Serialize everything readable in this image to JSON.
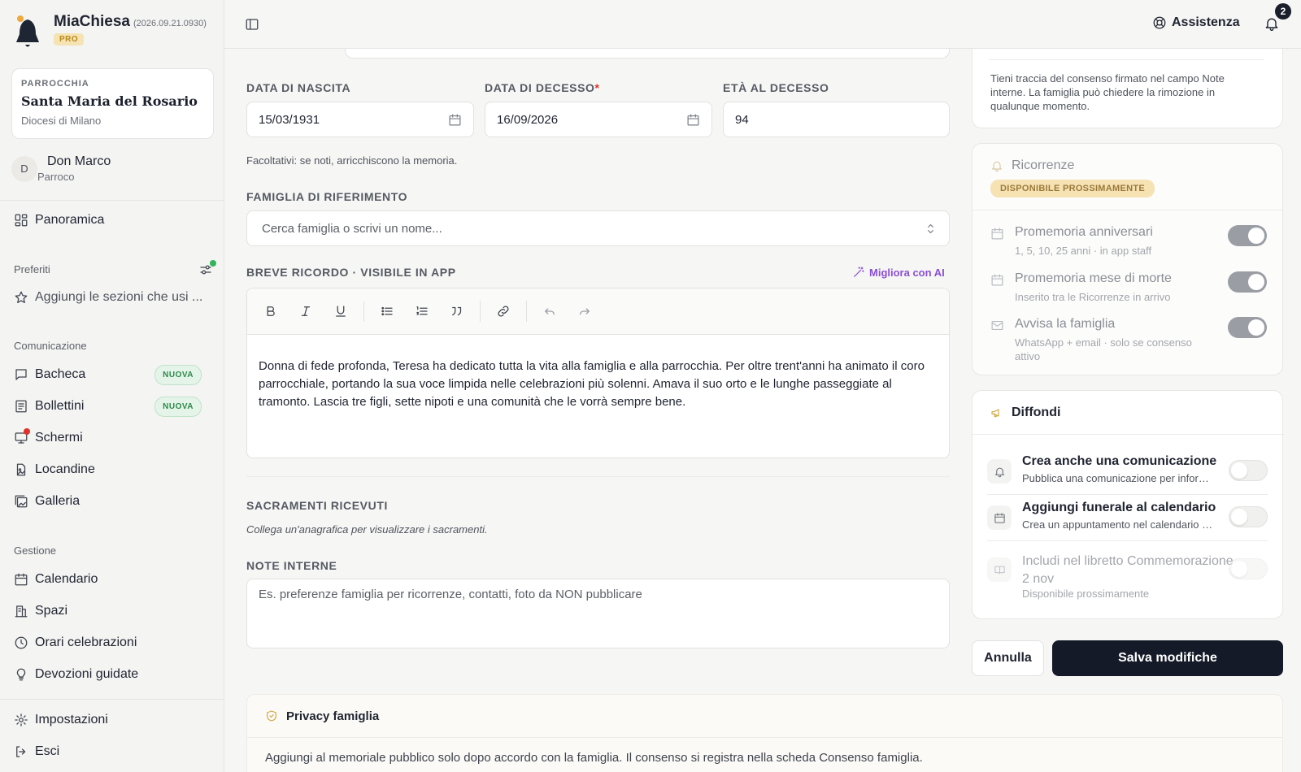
{
  "app": {
    "name": "MiaChiesa",
    "version": "(2026.09.21.0930)",
    "plan": "PRO"
  },
  "parish": {
    "label": "PARROCCHIA",
    "name": "Santa Maria del Rosario",
    "diocese": "Diocesi di Milano"
  },
  "user": {
    "initial": "D",
    "name": "Don Marco",
    "role": "Parroco"
  },
  "nav": {
    "overview": "Panoramica",
    "favorites_label": "Preferiti",
    "favorites_add": "Aggiungi le sezioni che usi ...",
    "communication_label": "Comunicazione",
    "communication": [
      {
        "label": "Bacheca",
        "badge": "NUOVA",
        "icon": "message-icon"
      },
      {
        "label": "Bollettini",
        "badge": "NUOVA",
        "icon": "newspaper-icon"
      },
      {
        "label": "Schermi",
        "badge": "",
        "icon": "monitor-icon"
      },
      {
        "label": "Locandine",
        "badge": "",
        "icon": "file-image-icon"
      },
      {
        "label": "Galleria",
        "badge": "",
        "icon": "gallery-icon"
      }
    ],
    "management_label": "Gestione",
    "management": [
      {
        "label": "Calendario",
        "icon": "calendar-icon"
      },
      {
        "label": "Spazi",
        "icon": "building-icon"
      },
      {
        "label": "Orari celebrazioni",
        "icon": "clock-icon"
      },
      {
        "label": "Devozioni guidate",
        "icon": "lightbulb-icon"
      }
    ],
    "settings": "Impostazioni",
    "logout": "Esci"
  },
  "topbar": {
    "help": "Assistenza",
    "notifications_count": "2"
  },
  "form": {
    "birth_label": "DATA DI NASCITA",
    "birth_value": "15/03/1931",
    "death_label": "DATA DI DECESSO",
    "death_value": "16/09/2026",
    "age_label": "ETÀ AL DECESSO",
    "age_value": "94",
    "dates_hint": "Facoltativi: se noti, arricchiscono la memoria.",
    "family_label": "FAMIGLIA DI RIFERIMENTO",
    "family_placeholder": "Cerca famiglia o scrivi un nome...",
    "memory_label": "BREVE RICORDO · VISIBILE IN APP",
    "ai_link": "Migliora con AI",
    "memory_text": "Donna di fede profonda, Teresa ha dedicato tutta la vita alla famiglia e alla parrocchia. Per oltre trent'anni ha animato il coro parrocchiale, portando la sua voce limpida nelle celebrazioni più solenni. Amava il suo orto e le lunghe passeggiate al tramonto. Lascia tre figli, sette nipoti e una comunità che le vorrà sempre bene.",
    "sacraments_label": "SACRAMENTI RICEVUTI",
    "sacraments_hint": "Collega un'anagrafica per visualizzare i sacramenti.",
    "notes_label": "NOTE INTERNE",
    "notes_placeholder": "Es. preferenze famiglia per ricorrenze, contatti, foto da NON pubblicare"
  },
  "privacy": {
    "title": "Privacy famiglia",
    "text": "Aggiungi al memoriale pubblico solo dopo accordo con la famiglia. Il consenso si registra nella scheda Consenso famiglia."
  },
  "consent_card": {
    "text": "Tieni traccia del consenso firmato nel campo Note interne. La famiglia può chiedere la rimozione in qualunque momento."
  },
  "recurrences": {
    "title": "Ricorrenze",
    "badge": "DISPONIBILE PROSSIMAMENTE",
    "items": [
      {
        "title": "Promemoria anniversari",
        "sub": "1, 5, 10, 25 anni · in app staff",
        "on": true
      },
      {
        "title": "Promemoria mese di morte",
        "sub": "Inserito tra le Ricorrenze in arrivo",
        "on": true
      },
      {
        "title": "Avvisa la famiglia",
        "sub": "WhatsApp + email · solo se consenso attivo",
        "on": true
      }
    ]
  },
  "share": {
    "title": "Diffondi",
    "items": [
      {
        "title": "Crea anche una comunicazione",
        "sub": "Pubblica una comunicazione per informare la comunità",
        "on": false
      },
      {
        "title": "Aggiungi funerale al calendario",
        "sub": "Crea un appuntamento nel calendario parrocchiale",
        "on": false
      },
      {
        "title": "Includi nel libretto Commemorazione 2 nov",
        "sub": "Disponibile prossimamente",
        "on": false
      }
    ]
  },
  "actions": {
    "cancel": "Annulla",
    "save": "Salva modifiche"
  },
  "colors": {
    "accent_dark": "#141a27",
    "badge_green": "#2d8a4a",
    "badge_gold": "#f7e2b4",
    "ai_purple": "#8a4fd6",
    "required_red": "#e0322b"
  }
}
